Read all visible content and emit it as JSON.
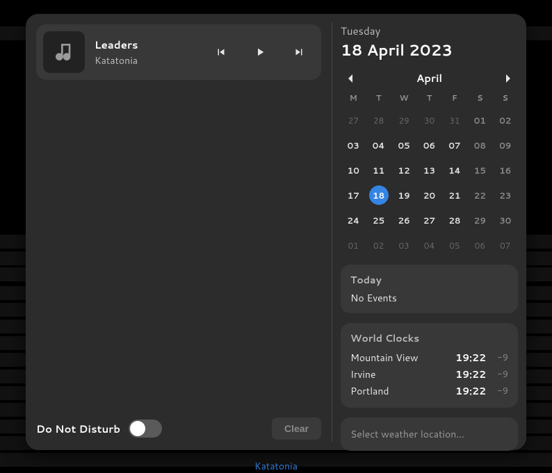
{
  "media": {
    "title": "Leaders",
    "artist": "Katatonia"
  },
  "dnd": {
    "label": "Do Not Disturb",
    "enabled": false
  },
  "clear_label": "Clear",
  "date": {
    "weekday": "Tuesday",
    "full": "18 April 2023"
  },
  "calendar": {
    "month": "April",
    "dow": [
      "M",
      "T",
      "W",
      "T",
      "F",
      "S",
      "S"
    ],
    "weeks": [
      [
        {
          "d": "27",
          "t": "out"
        },
        {
          "d": "28",
          "t": "out"
        },
        {
          "d": "29",
          "t": "out"
        },
        {
          "d": "30",
          "t": "out"
        },
        {
          "d": "31",
          "t": "out"
        },
        {
          "d": "01",
          "t": "we"
        },
        {
          "d": "02",
          "t": "we"
        }
      ],
      [
        {
          "d": "03",
          "t": "in"
        },
        {
          "d": "04",
          "t": "in"
        },
        {
          "d": "05",
          "t": "in"
        },
        {
          "d": "06",
          "t": "in"
        },
        {
          "d": "07",
          "t": "in"
        },
        {
          "d": "08",
          "t": "we"
        },
        {
          "d": "09",
          "t": "we"
        }
      ],
      [
        {
          "d": "10",
          "t": "in"
        },
        {
          "d": "11",
          "t": "in"
        },
        {
          "d": "12",
          "t": "in"
        },
        {
          "d": "13",
          "t": "in"
        },
        {
          "d": "14",
          "t": "in"
        },
        {
          "d": "15",
          "t": "we"
        },
        {
          "d": "16",
          "t": "we"
        }
      ],
      [
        {
          "d": "17",
          "t": "in"
        },
        {
          "d": "18",
          "t": "sel"
        },
        {
          "d": "19",
          "t": "in"
        },
        {
          "d": "20",
          "t": "in"
        },
        {
          "d": "21",
          "t": "in"
        },
        {
          "d": "22",
          "t": "we"
        },
        {
          "d": "23",
          "t": "we"
        }
      ],
      [
        {
          "d": "24",
          "t": "in"
        },
        {
          "d": "25",
          "t": "in"
        },
        {
          "d": "26",
          "t": "in"
        },
        {
          "d": "27",
          "t": "in"
        },
        {
          "d": "28",
          "t": "in"
        },
        {
          "d": "29",
          "t": "we"
        },
        {
          "d": "30",
          "t": "we"
        }
      ],
      [
        {
          "d": "01",
          "t": "out"
        },
        {
          "d": "02",
          "t": "out"
        },
        {
          "d": "03",
          "t": "out"
        },
        {
          "d": "04",
          "t": "out"
        },
        {
          "d": "05",
          "t": "out"
        },
        {
          "d": "06",
          "t": "out"
        },
        {
          "d": "07",
          "t": "out"
        }
      ]
    ]
  },
  "events": {
    "heading": "Today",
    "empty": "No Events"
  },
  "clocks": {
    "heading": "World Clocks",
    "rows": [
      {
        "city": "Mountain View",
        "time": "19:22",
        "offset": "-9"
      },
      {
        "city": "Irvine",
        "time": "19:22",
        "offset": "-9"
      },
      {
        "city": "Portland",
        "time": "19:22",
        "offset": "-9"
      }
    ]
  },
  "weather": {
    "placeholder": "Select weather location…"
  },
  "footer": {
    "artist": "Katatonia"
  }
}
